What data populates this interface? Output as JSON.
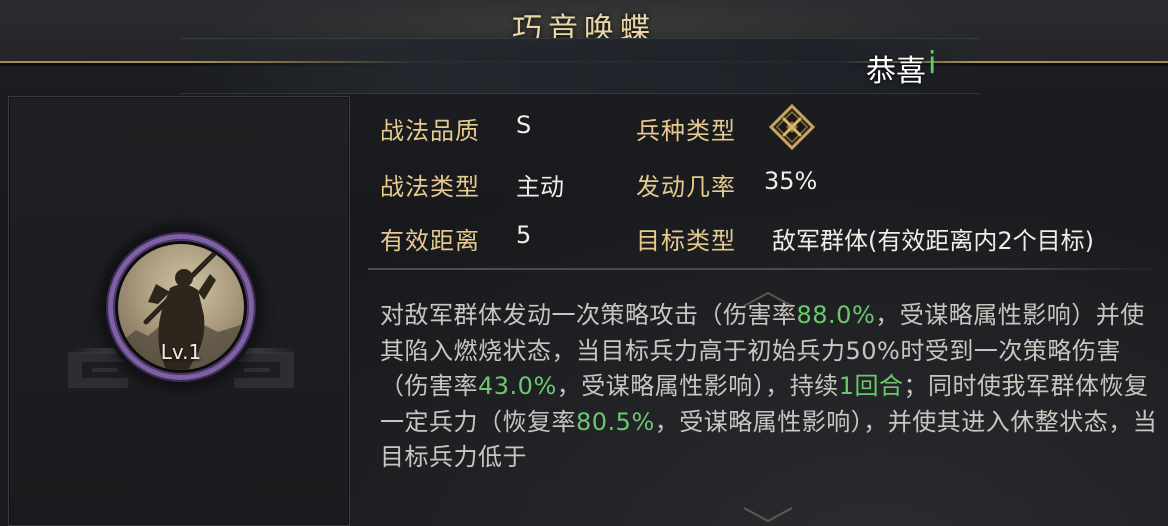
{
  "title": "巧音唤蝶",
  "toast": {
    "text": "恭喜",
    "tail": "i"
  },
  "portrait": {
    "level": "Lv.1"
  },
  "info": {
    "quality_label": "战法品质",
    "quality_value": "S",
    "troop_label": "兵种类型",
    "type_label": "战法类型",
    "type_value": "主动",
    "rate_label": "发动几率",
    "rate_value": "35%",
    "range_label": "有效距离",
    "range_value": "5",
    "target_label": "目标类型",
    "target_value": "敌军群体(有效距离内2个目标)"
  },
  "description": {
    "segments": [
      {
        "t": "对敌军群体发动一次策略攻击（伤害率",
        "h": false
      },
      {
        "t": "88.0%",
        "h": true
      },
      {
        "t": "，受谋略属性影响）并使其陷入燃烧状态，当目标兵力高于初始兵力50%时受到一次策略伤害（伤害率",
        "h": false
      },
      {
        "t": "43.0%",
        "h": true
      },
      {
        "t": "，受谋略属性影响），持续",
        "h": false
      },
      {
        "t": "1回合",
        "h": true
      },
      {
        "t": "；同时使我军群体恢复一定兵力（恢复率",
        "h": false
      },
      {
        "t": "80.5%",
        "h": true
      },
      {
        "t": "，受谋略属性影响），并使其进入休整状态，当目标兵力低于",
        "h": false
      }
    ]
  },
  "colors": {
    "label_gold": "#e6c98f",
    "value_white": "#f0ede6",
    "highlight_green": "#6cc76f",
    "ring_purple": "#7f5fa6",
    "title_gold": "#ead7a8"
  }
}
